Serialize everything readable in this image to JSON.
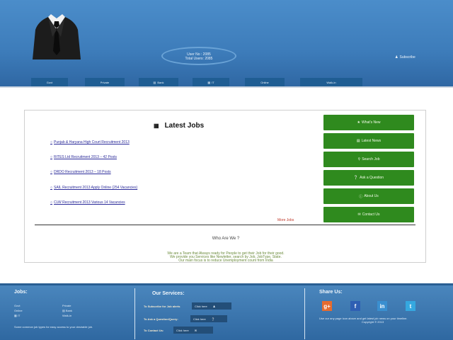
{
  "header": {
    "user_no": "User No : 2085",
    "total_users": "Total Users: 2085",
    "subscribe_label": "Subscribe"
  },
  "nav": [
    {
      "label": "Govt",
      "icon": ""
    },
    {
      "label": "Private",
      "icon": ""
    },
    {
      "label": "Bank",
      "icon": "bank-icon"
    },
    {
      "label": "IT",
      "icon": "it-icon"
    },
    {
      "label": "Online",
      "icon": ""
    },
    {
      "label": "Walk-in",
      "icon": ""
    }
  ],
  "main": {
    "title": "Latest Jobs",
    "jobs": [
      "Punjab & Haryana High Court Recruitment 2013",
      "RITES Ltd Recruitment 2013 – 42 Posts",
      "DRDO Recruitment 2013 – 18 Posts",
      "SAIL Recruitment 2013 Apply Online (254 Vacancies)",
      "CLW Recruitment 2013 Various 14 Vacancies"
    ],
    "more_jobs": "More Jobs",
    "who_title": "Who Are We ?",
    "who_lines": [
      "We are a Team that Always ready for People to get their Job for their good.",
      "We provide you Services like Newletter, search by Job, JobType, State.",
      "Our main focus is to reduce Unemployment count from India"
    ]
  },
  "sidebar": [
    {
      "label": "What's New",
      "icon": "star-icon"
    },
    {
      "label": "Latest News",
      "icon": "news-icon"
    },
    {
      "label": "Search Job",
      "icon": "search-icon"
    },
    {
      "label": "Ask a Question",
      "icon": "question-icon"
    },
    {
      "label": "About Us",
      "icon": "info-icon"
    },
    {
      "label": "Contact Us",
      "icon": "contact-icon"
    }
  ],
  "footer": {
    "jobs_heading": "Jobs:",
    "job_links": [
      "Govt",
      "Private",
      "Online",
      "Bank",
      "IT",
      "Walk-in"
    ],
    "jobs_note": "Some common job types for easy access to your desirable job.",
    "services_heading": "Our Services:",
    "services": [
      {
        "label": "To Subscribe for Job alerts",
        "button": "Click here"
      },
      {
        "label": "To Ask a Question/Query:",
        "button": "Click here"
      },
      {
        "label": "To Contact Us:",
        "button": "Click here"
      }
    ],
    "share_heading": "Share Us:",
    "social": [
      {
        "name": "google-plus",
        "glyph": "g+",
        "color": "#e56b2f"
      },
      {
        "name": "facebook",
        "glyph": "f",
        "color": "#2f5fb3"
      },
      {
        "name": "linkedin",
        "glyph": "in",
        "color": "#3a8fd0"
      },
      {
        "name": "twitter",
        "glyph": "t",
        "color": "#35a8e0"
      }
    ],
    "share_note": "Use our any page icon above and get latest job news on your timeline.",
    "copyright": "Copyright © 2013"
  }
}
